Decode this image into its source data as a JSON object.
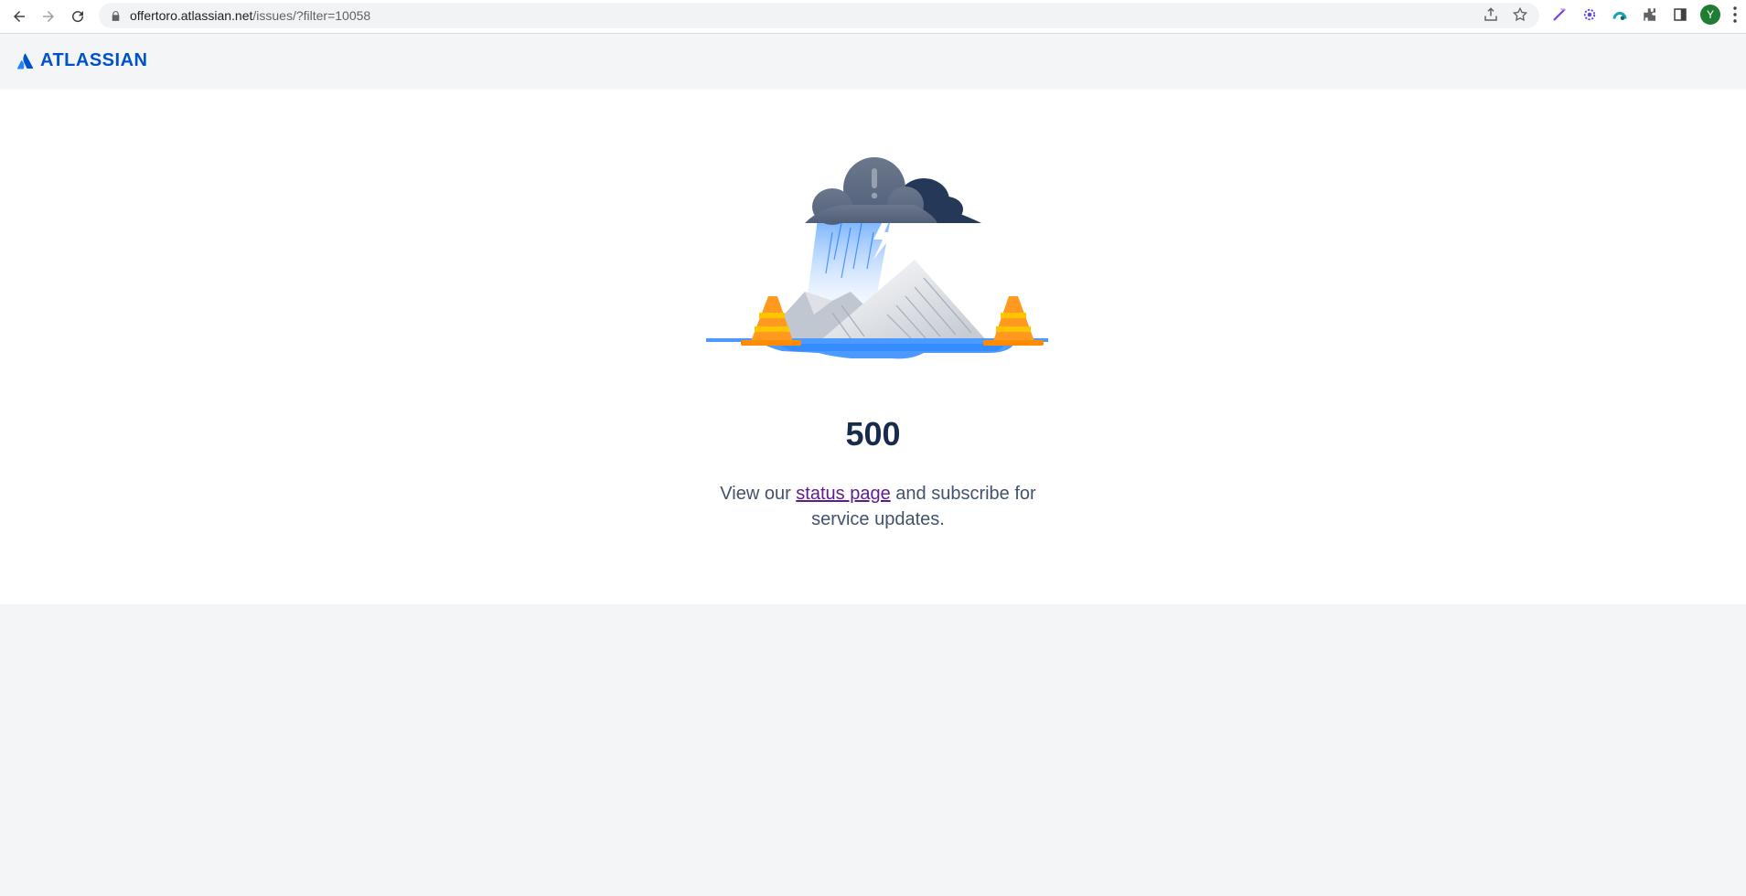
{
  "browser": {
    "url_host": "offertoro.atlassian.net",
    "url_path": "/issues/?filter=10058",
    "profile_initial": "Y"
  },
  "header": {
    "logo_text": "ATLASSIAN",
    "brand_color": "#0052cc"
  },
  "error": {
    "code": "500",
    "message_prefix": "View our ",
    "link_text": "status page",
    "message_suffix": " and subscribe for service updates."
  },
  "icons": [
    "back-icon",
    "forward-icon",
    "reload-icon",
    "lock-icon",
    "share-icon",
    "star-icon",
    "extension-icon",
    "puzzle-icon",
    "sidebar-icon",
    "menu-icon"
  ]
}
